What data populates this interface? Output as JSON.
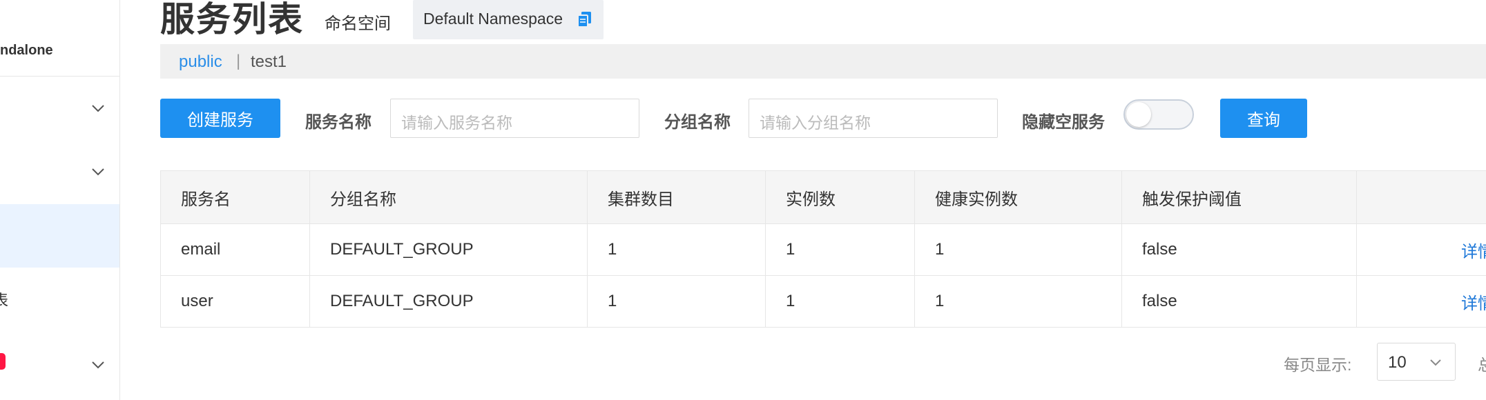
{
  "sidebar": {
    "top_cut_text": "...",
    "mode_label": "ndalone",
    "items": [
      {
        "label": ""
      },
      {
        "label": ""
      },
      {
        "label": ""
      },
      {
        "label": "表"
      },
      {
        "label": ""
      }
    ]
  },
  "header": {
    "title": "服务列表",
    "namespace_label": "命名空间",
    "namespace_value": "Default Namespace"
  },
  "namespace_bar": {
    "items": [
      "public",
      "test1"
    ],
    "separator": "|"
  },
  "filters": {
    "create_button": "创建服务",
    "service_name_label": "服务名称",
    "service_name_placeholder": "请输入服务名称",
    "group_name_label": "分组名称",
    "group_name_placeholder": "请输入分组名称",
    "hide_empty_label": "隐藏空服务",
    "hide_empty_on": false,
    "query_button": "查询"
  },
  "table": {
    "columns": [
      "服务名",
      "分组名称",
      "集群数目",
      "实例数",
      "健康实例数",
      "触发保护阈值",
      ""
    ],
    "rows": [
      {
        "name": "email",
        "group": "DEFAULT_GROUP",
        "clusters": "1",
        "instances": "1",
        "healthy": "1",
        "protect": "false",
        "action": "详情"
      },
      {
        "name": "user",
        "group": "DEFAULT_GROUP",
        "clusters": "1",
        "instances": "1",
        "healthy": "1",
        "protect": "false",
        "action": "详情"
      }
    ]
  },
  "pagination": {
    "per_page_label": "每页显示:",
    "per_page_value": "10",
    "total_label": "总"
  },
  "colors": {
    "primary": "#1e90f0",
    "link": "#2b8ee8",
    "active_bg": "#eaf3ff",
    "badge": "#ff1744"
  }
}
